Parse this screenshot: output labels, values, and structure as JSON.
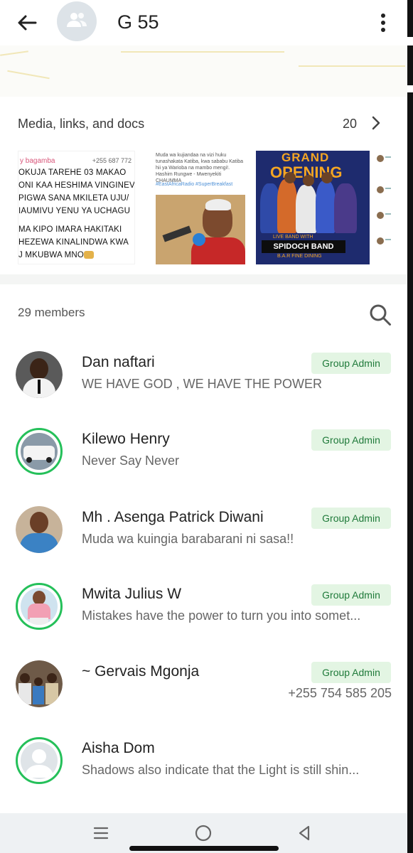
{
  "header": {
    "title": "G 55",
    "back_icon": "arrow-left-icon",
    "menu_icon": "more-vertical-icon",
    "avatar_icon": "group-icon"
  },
  "media": {
    "label": "Media, links, and docs",
    "count": "20",
    "thumb1": {
      "name": "y bagamba",
      "phone": "+255 687 772",
      "lines": [
        "OKUJA TAREHE 03 MAKAO",
        "ONI KAA HESHIMA VINGINEV",
        "PIGWA SANA MKILETA UJU/",
        "IAUMIVU YENU YA UCHAGU",
        "MA KIPO IMARA HAKITAKI",
        "HEZEWA KINALINDWA KWA",
        "J MKUBWA MNO"
      ]
    },
    "thumb2": {
      "text": "Muda wa kujiandaa na vizi huku tunashakata Katiba, kwa sababu Katiba hii ya Warioba na mambo mengi!. Hashim Rungwe - Mwenyekiti CHAUMMA",
      "tags": "#EastAfricaRadio #SuperBreakfast"
    },
    "thumb3": {
      "title_top": "GRAND",
      "title_bottom": "OPENING",
      "live": "LIVE BAND WITH",
      "band": "SPIDOCH BAND",
      "sub": "B.A.R FINE DINING"
    }
  },
  "members": {
    "label": "29 members",
    "search_icon": "search-icon",
    "admin_label": "Group Admin",
    "list": [
      {
        "name": "Dan naftari",
        "status": "WE HAVE GOD , WE HAVE THE POWER",
        "admin": true,
        "ring": false
      },
      {
        "name": "Kilewo Henry",
        "status": "Never Say Never",
        "admin": true,
        "ring": true
      },
      {
        "name": "Mh . Asenga Patrick Diwani",
        "status": "Muda wa kuingia barabarani ni sasa!!",
        "admin": true,
        "ring": false
      },
      {
        "name": "Mwita Julius W",
        "status": "Mistakes have the power to turn you into somet...",
        "admin": true,
        "ring": true
      },
      {
        "name": "~ Gervais Mgonja",
        "status": "",
        "phone": "+255 754 585 205",
        "admin": true,
        "ring": false
      },
      {
        "name": "Aisha Dom",
        "status": "Shadows also indicate that the Light is still shin...",
        "admin": false,
        "ring": true
      }
    ]
  },
  "navbar": {
    "recent_icon": "recent-apps-icon",
    "home_icon": "home-circle-icon",
    "back_icon": "back-triangle-icon"
  },
  "colors": {
    "accent_green": "#25c05a",
    "admin_badge_bg": "#e3f5e3",
    "admin_badge_text": "#1f7a3a"
  }
}
